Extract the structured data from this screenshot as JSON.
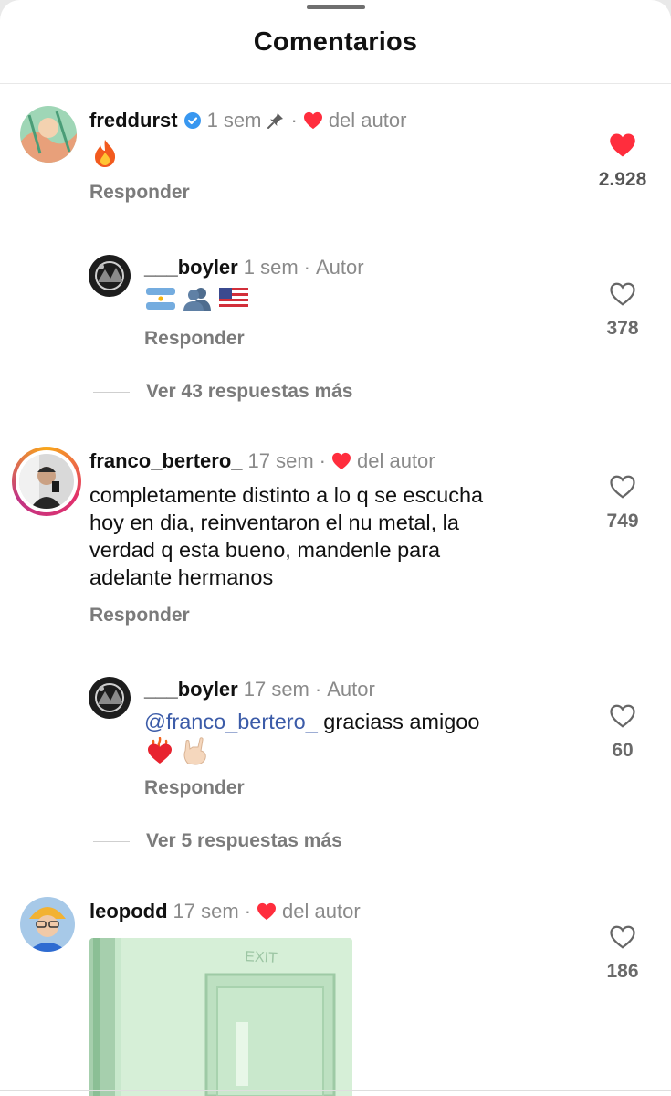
{
  "header": {
    "title": "Comentarios"
  },
  "comments": [
    {
      "username": "freddurst",
      "time": "1 sem",
      "separator": "·",
      "author_like_label": "del autor",
      "likes": "2.928",
      "liked": true,
      "reply_label": "Responder",
      "emojis": [
        "fire"
      ],
      "replies": [
        {
          "username": "___boyler",
          "time": "1 sem",
          "separator": "·",
          "author_tag": "Autor",
          "emojis": [
            "argentina-flag",
            "busts-in-silhouette",
            "usa-flag"
          ],
          "likes": "378",
          "reply_label": "Responder"
        }
      ],
      "more_replies": "Ver 43 respuestas más"
    },
    {
      "username": "franco_bertero_",
      "time": "17 sem",
      "separator": "·",
      "author_like_label": "del autor",
      "text_lines": [
        "completamente distinto a lo q se escucha",
        "hoy en dia, reinventaron el nu metal, la",
        "verdad q esta bueno, mandenle para",
        "adelante hermanos"
      ],
      "likes": "749",
      "reply_label": "Responder",
      "replies": [
        {
          "username": "___boyler",
          "time": "17 sem",
          "separator": "·",
          "author_tag": "Autor",
          "mention": "@franco_bertero_",
          "text": " graciass amigoo",
          "emojis": [
            "heart-on-fire",
            "sign-of-the-horns"
          ],
          "likes": "60",
          "reply_label": "Responder"
        }
      ],
      "more_replies": "Ver 5 respuestas más"
    },
    {
      "username": "leopodd",
      "time": "17 sem",
      "separator": "·",
      "author_like_label": "del autor",
      "likes": "186",
      "media_text": "EXIT"
    }
  ],
  "colors": {
    "like_red": "#ff2d3d",
    "verified_blue": "#3897f0",
    "mention_blue": "#3b5ba8",
    "muted_gray": "#8a8a8a"
  }
}
